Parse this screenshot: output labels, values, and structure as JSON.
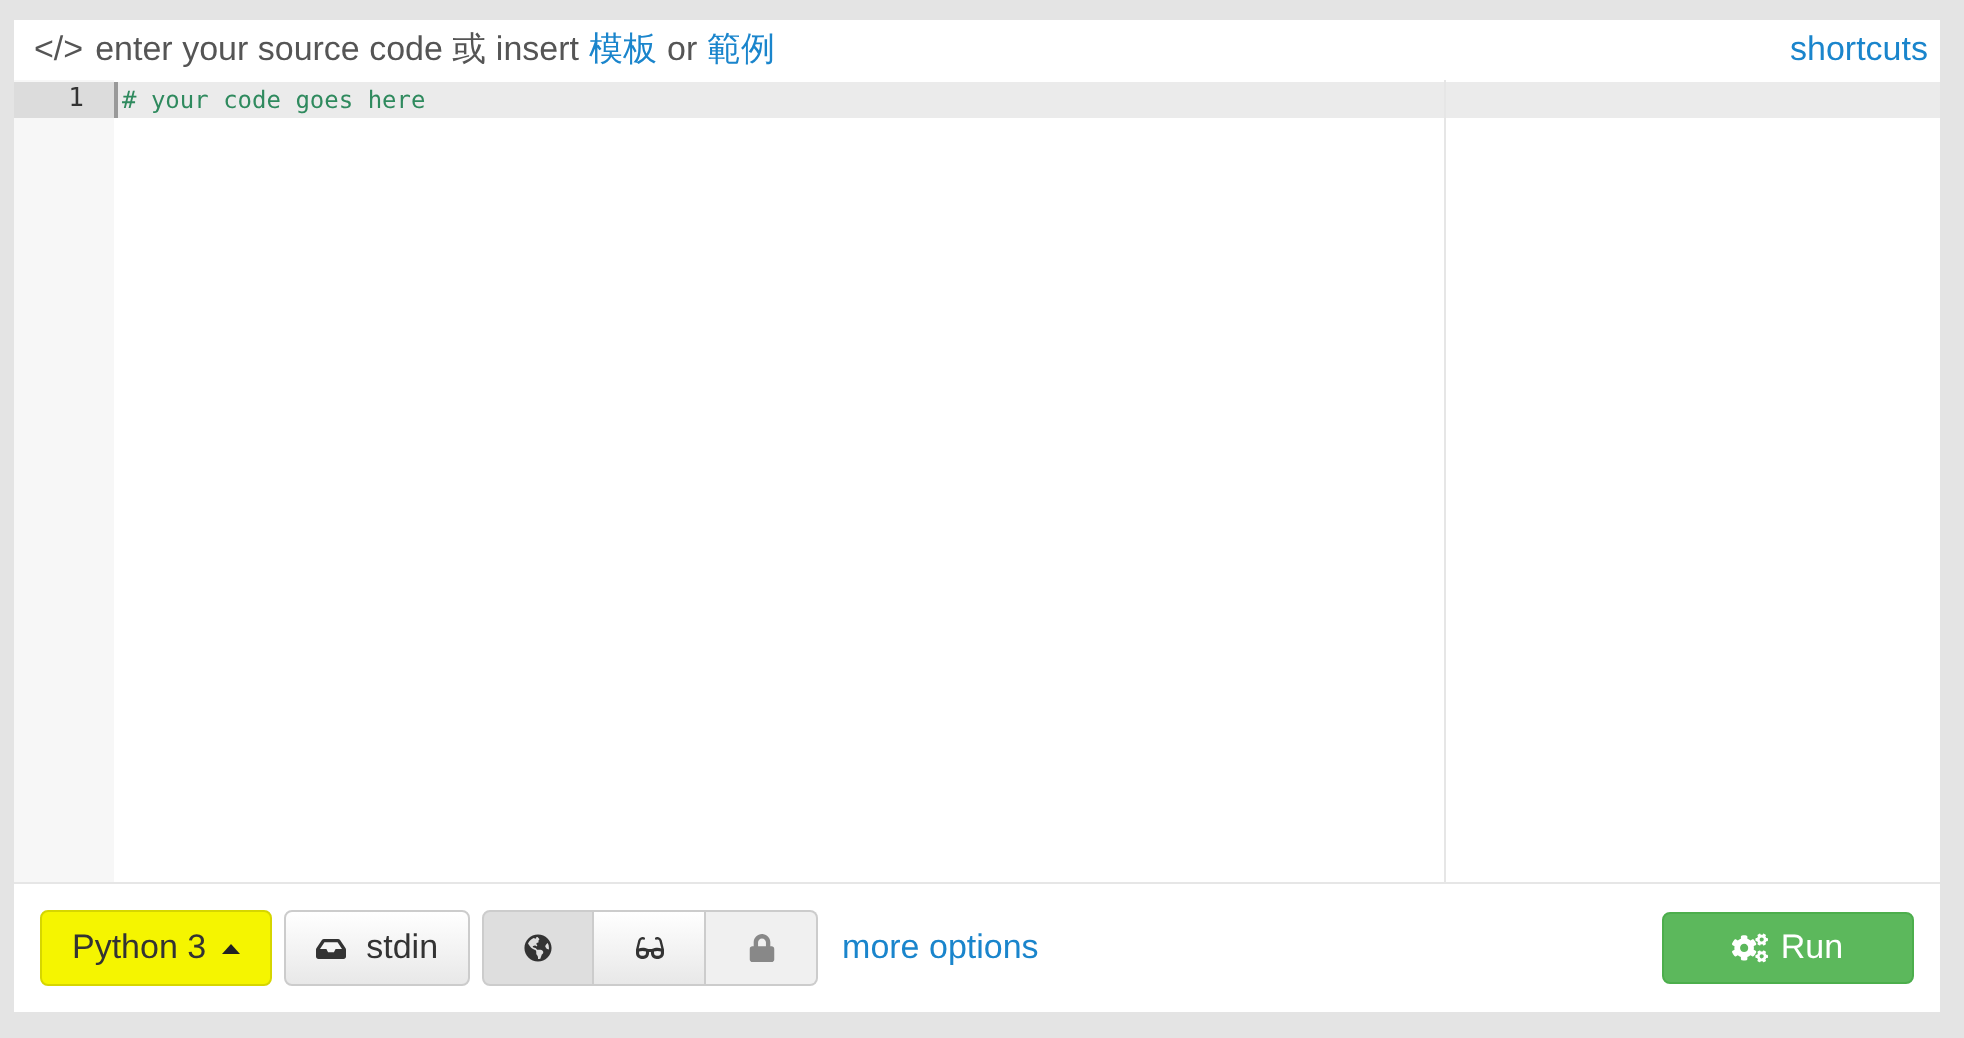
{
  "header": {
    "icon_text": "</>",
    "prompt": "enter your source code 或 insert",
    "template_link": "模板",
    "or": "or",
    "example_link": "範例",
    "shortcuts_link": "shortcuts"
  },
  "editor": {
    "lines": [
      {
        "number": "1",
        "text": "# your code goes here",
        "active": true
      }
    ]
  },
  "toolbar": {
    "language": {
      "label": "Python 3",
      "highlighted": true
    },
    "stdin": {
      "label": "stdin"
    },
    "visibility": [
      {
        "kind": "globe",
        "selected": true,
        "disabled": false
      },
      {
        "kind": "glasses",
        "selected": false,
        "disabled": false
      },
      {
        "kind": "lock",
        "selected": false,
        "disabled": true
      }
    ],
    "more_options": "more options",
    "run": {
      "label": "Run"
    }
  }
}
